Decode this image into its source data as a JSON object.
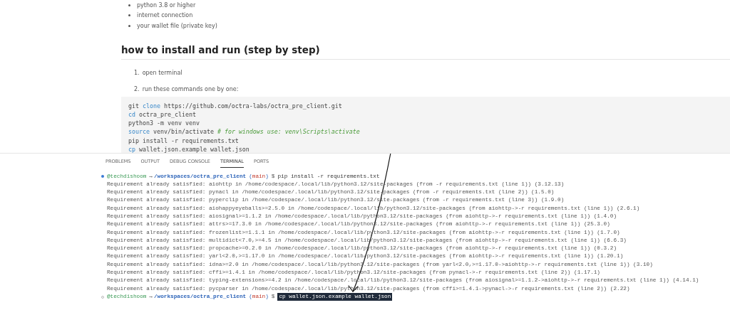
{
  "doc": {
    "bullets": [
      "python 3.8 or higher",
      "internet connection",
      "your wallet file (private key)"
    ],
    "heading": "how to install and run (step by step)",
    "steps": [
      {
        "number": "1.",
        "text": "open terminal"
      },
      {
        "number": "2.",
        "text": "run these commands one by one:"
      }
    ],
    "code_lines": [
      [
        {
          "kind": "plain",
          "text": "git "
        },
        {
          "kind": "keyword",
          "text": "clone"
        },
        {
          "kind": "plain",
          "text": " https://github.com/octra-labs/octra_pre_client.git"
        }
      ],
      [
        {
          "kind": "keyword",
          "text": "cd"
        },
        {
          "kind": "plain",
          "text": " octra_pre_client"
        }
      ],
      [
        {
          "kind": "plain",
          "text": "python3 -m venv venv"
        }
      ],
      [
        {
          "kind": "keyword",
          "text": "source"
        },
        {
          "kind": "plain",
          "text": " venv/bin/activate "
        },
        {
          "kind": "comment",
          "text": "# for windows use: venv\\Scripts\\activate"
        }
      ],
      [
        {
          "kind": "plain",
          "text": "pip install -r requirements.txt"
        }
      ],
      [
        {
          "kind": "keyword",
          "text": "cp"
        },
        {
          "kind": "plain",
          "text": " wallet.json.example wallet.json"
        }
      ]
    ]
  },
  "panel": {
    "tabs": [
      {
        "label": "PROBLEMS",
        "selected": false
      },
      {
        "label": "OUTPUT",
        "selected": false
      },
      {
        "label": "DEBUG CONSOLE",
        "selected": false
      },
      {
        "label": "TERMINAL",
        "selected": true
      },
      {
        "label": "PORTS",
        "selected": false
      }
    ],
    "terminal": [
      {
        "kind": "prompt",
        "done": true,
        "user": "@techdishoom",
        "arrow": "→",
        "path": "/workspaces/octra_pre_client",
        "branch_open": "(",
        "branch": "main",
        "branch_close": ")",
        "dollar": "$",
        "command": "pip install -r requirements.txt",
        "selected": false
      },
      {
        "kind": "output",
        "text": "Requirement already satisfied: aiohttp in /home/codespace/.local/lib/python3.12/site-packages (from -r requirements.txt (line 1)) (3.12.13)"
      },
      {
        "kind": "output",
        "text": "Requirement already satisfied: pynacl in /home/codespace/.local/lib/python3.12/site-packages (from -r requirements.txt (line 2)) (1.5.0)"
      },
      {
        "kind": "output",
        "text": "Requirement already satisfied: pyperclip in /home/codespace/.local/lib/python3.12/site-packages (from -r requirements.txt (line 3)) (1.9.0)"
      },
      {
        "kind": "output",
        "text": "Requirement already satisfied: aiohappyeyeballs>=2.5.0 in /home/codespace/.local/lib/python3.12/site-packages (from aiohttp->-r requirements.txt (line 1)) (2.6.1)"
      },
      {
        "kind": "output",
        "text": "Requirement already satisfied: aiosignal>=1.1.2 in /home/codespace/.local/lib/python3.12/site-packages (from aiohttp->-r requirements.txt (line 1)) (1.4.0)"
      },
      {
        "kind": "output",
        "text": "Requirement already satisfied: attrs>=17.3.0 in /home/codespace/.local/lib/python3.12/site-packages (from aiohttp->-r requirements.txt (line 1)) (25.3.0)"
      },
      {
        "kind": "output",
        "text": "Requirement already satisfied: frozenlist>=1.1.1 in /home/codespace/.local/lib/python3.12/site-packages (from aiohttp->-r requirements.txt (line 1)) (1.7.0)"
      },
      {
        "kind": "output",
        "text": "Requirement already satisfied: multidict<7.0,>=4.5 in /home/codespace/.local/lib/python3.12/site-packages (from aiohttp->-r requirements.txt (line 1)) (6.6.3)"
      },
      {
        "kind": "output",
        "text": "Requirement already satisfied: propcache>=0.2.0 in /home/codespace/.local/lib/python3.12/site-packages (from aiohttp->-r requirements.txt (line 1)) (0.3.2)"
      },
      {
        "kind": "output",
        "text": "Requirement already satisfied: yarl<2.0,>=1.17.0 in /home/codespace/.local/lib/python3.12/site-packages (from aiohttp->-r requirements.txt (line 1)) (1.20.1)"
      },
      {
        "kind": "output",
        "text": "Requirement already satisfied: idna>=2.0 in /home/codespace/.local/lib/python3.12/site-packages (from yarl<2.0,>=1.17.0->aiohttp->-r requirements.txt (line 1)) (3.10)"
      },
      {
        "kind": "output",
        "text": "Requirement already satisfied: cffi>=1.4.1 in /home/codespace/.local/lib/python3.12/site-packages (from pynacl->-r requirements.txt (line 2)) (1.17.1)"
      },
      {
        "kind": "output",
        "text": "Requirement already satisfied: typing-extensions>=4.2 in /home/codespace/.local/lib/python3.12/site-packages (from aiosignal>=1.1.2->aiohttp->-r requirements.txt (line 1)) (4.14.1)"
      },
      {
        "kind": "output",
        "text": "Requirement already satisfied: pycparser in /home/codespace/.local/lib/python3.12/site-packages (from cffi>=1.4.1->pynacl->-r requirements.txt (line 2)) (2.22)"
      },
      {
        "kind": "prompt",
        "done": false,
        "user": "@techdishoom",
        "arrow": "→",
        "path": "/workspaces/octra_pre_client",
        "branch_open": "(",
        "branch": "main",
        "branch_close": ")",
        "dollar": "$",
        "command": "cp wallet.json.example wallet.json",
        "selected": true
      }
    ]
  }
}
